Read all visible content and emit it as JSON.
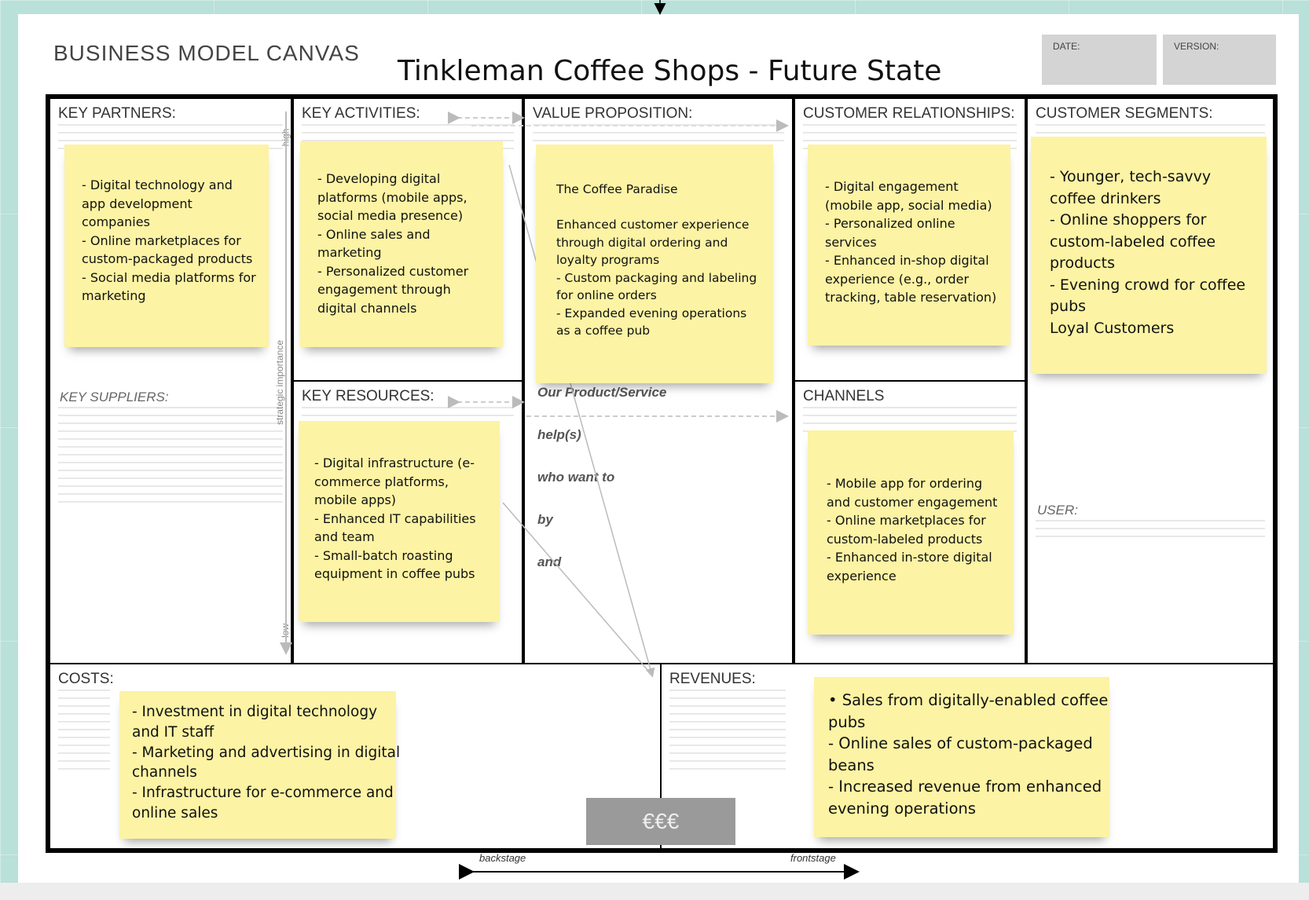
{
  "canvas_label": "BUSINESS MODEL CANVAS",
  "title": "Tinkleman Coffee Shops - Future State",
  "meta": {
    "date_label": "DATE:",
    "version_label": "VERSION:"
  },
  "sections": {
    "key_partners": "KEY PARTNERS:",
    "key_suppliers": "KEY SUPPLIERS:",
    "key_activities": "KEY ACTIVITIES:",
    "key_resources": "KEY RESOURCES:",
    "value_proposition": "VALUE PROPOSITION:",
    "customer_relationships": "CUSTOMER RELATIONSHIPS:",
    "channels": "CHANNELS",
    "customer_segments": "CUSTOMER SEGMENTS:",
    "user": "USER:",
    "costs": "COSTS:",
    "revenues": "REVENUES:"
  },
  "value_prop_template": {
    "heading": "Our Product/Service",
    "help": "help(s)",
    "who": "who want to",
    "by": "by",
    "and": "and"
  },
  "side_labels": {
    "high": "high",
    "importance": "strategic importance",
    "low": "low"
  },
  "stages": {
    "back": "backstage",
    "front": "frontstage"
  },
  "cost_symbol": "€€€",
  "notes": {
    "key_partners": [
      "- Digital technology and",
      "app development",
      "companies",
      "- Online marketplaces for",
      "custom-packaged products",
      "- Social media platforms for",
      "marketing"
    ],
    "key_activities": [
      "- Developing digital",
      "platforms (mobile apps,",
      "social media presence)",
      "- Online sales and",
      "marketing",
      "- Personalized customer",
      "engagement through",
      "digital channels"
    ],
    "value_proposition": [
      "The Coffee Paradise",
      "",
      "Enhanced customer experience",
      "through digital ordering and",
      "loyalty programs",
      "- Custom packaging and labeling",
      "for online orders",
      "- Expanded evening operations",
      "as a coffee pub"
    ],
    "customer_relationships": [
      "- Digital engagement",
      "(mobile app, social media)",
      "- Personalized online",
      "services",
      "- Enhanced in-shop digital",
      "experience (e.g., order",
      "tracking, table reservation)"
    ],
    "customer_segments": [
      "- Younger, tech-savvy",
      "coffee drinkers",
      "- Online shoppers for",
      "custom-labeled coffee",
      "products",
      "- Evening crowd for coffee",
      "pubs",
      "Loyal Customers"
    ],
    "key_resources": [
      "- Digital infrastructure (e-",
      "commerce platforms,",
      "mobile apps)",
      "- Enhanced IT capabilities",
      "and team",
      "- Small-batch roasting",
      "equipment in coffee pubs"
    ],
    "channels": [
      "- Mobile app for ordering",
      "and customer engagement",
      "- Online marketplaces for",
      "custom-labeled products",
      "- Enhanced in-store digital",
      "experience"
    ],
    "costs": [
      "- Investment in digital technology",
      "and IT staff",
      "- Marketing and advertising in digital",
      "channels",
      "- Infrastructure for e-commerce and",
      "online sales"
    ],
    "revenues": [
      "• Sales from digitally-enabled coffee",
      "pubs",
      "- Online sales of custom-packaged",
      "beans",
      "- Increased revenue from enhanced",
      "evening operations"
    ]
  }
}
